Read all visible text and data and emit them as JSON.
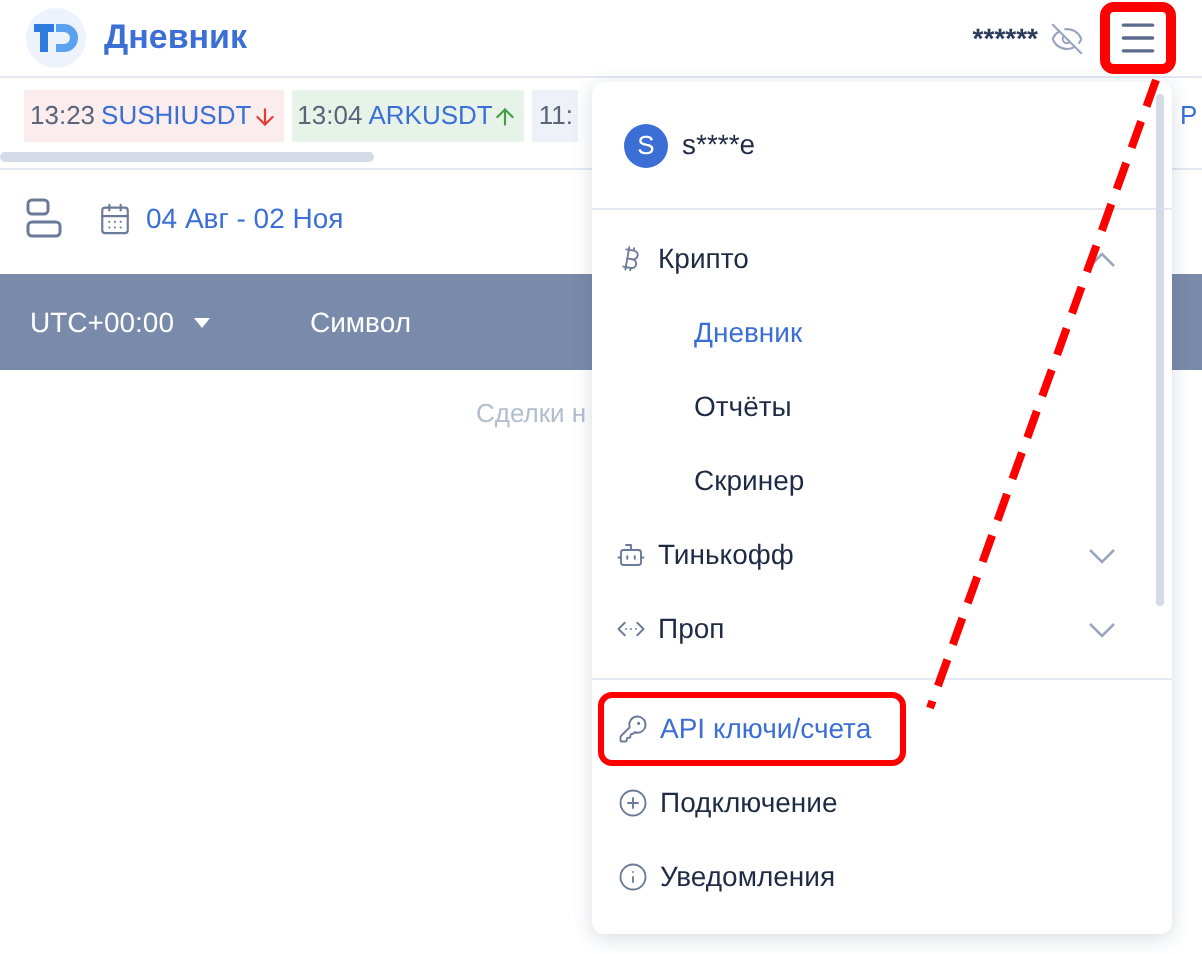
{
  "header": {
    "title": "Дневник",
    "balance": "******",
    "menu_button": {
      "highlighted": true
    }
  },
  "ticker": [
    {
      "time": "13:23",
      "symbol": "SUSHIUSDT",
      "kind": "down"
    },
    {
      "time": "13:04",
      "symbol": "ARKUSDT",
      "kind": "up"
    },
    {
      "time": "11:",
      "kind": "cut"
    }
  ],
  "ticker_tail": "Р",
  "toolbar": {
    "date_range": "04 Авг - 02 Ноя"
  },
  "table": {
    "columns": [
      {
        "label": "UTC+00:00",
        "dropdown": true
      },
      {
        "label": "Символ",
        "dropdown": false
      }
    ],
    "empty_text": "Сделки н"
  },
  "menu": {
    "user": {
      "initial": "S",
      "name": "s****e"
    },
    "items": [
      {
        "label": "Крипто",
        "kind": "group",
        "expanded": true,
        "children": [
          {
            "label": "Дневник",
            "selected": true
          },
          {
            "label": "Отчёты",
            "selected": false
          },
          {
            "label": "Скринер",
            "selected": false
          }
        ]
      },
      {
        "label": "Тинькофф",
        "kind": "group",
        "expanded": false
      },
      {
        "label": "Проп",
        "kind": "group",
        "expanded": false
      },
      {
        "kind": "divider"
      },
      {
        "label": "API ключи/счета",
        "kind": "link",
        "selected": true,
        "highlighted": true
      },
      {
        "label": "Подключение",
        "kind": "link",
        "selected": false,
        "highlighted": false
      },
      {
        "label": "Уведомления",
        "kind": "link",
        "selected": false,
        "highlighted": false
      }
    ]
  }
}
